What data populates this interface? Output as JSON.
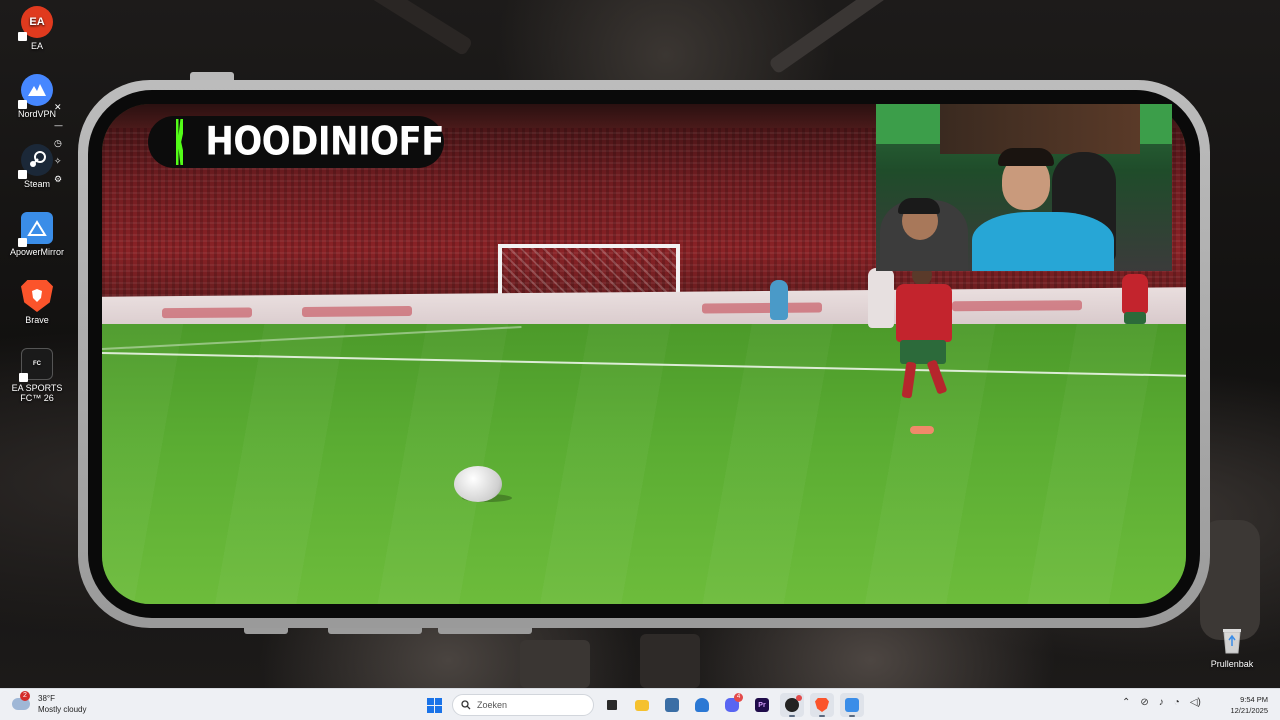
{
  "desktop_icons": [
    {
      "label": "EA",
      "icon": "ea-icon",
      "color": "#e03a1e"
    },
    {
      "label": "NordVPN",
      "icon": "nordvpn-icon",
      "color": "#4687ff"
    },
    {
      "label": "Steam",
      "icon": "steam-icon",
      "color": "#1b2838"
    },
    {
      "label": "ApowerMirror",
      "icon": "apowermirror-icon",
      "color": "#3a8de8"
    },
    {
      "label": "Brave",
      "icon": "brave-icon",
      "color": "#fb542b"
    },
    {
      "label": "EA SPORTS FC™ 26",
      "icon": "ea-sports-fc-icon",
      "color": "#1a1a1a"
    }
  ],
  "recycle_bin": {
    "label": "Prullenbak",
    "icon": "recycle-bin-icon"
  },
  "stream": {
    "watermark_name": "HOODINIOFF",
    "brand_color": "#53fc18"
  },
  "taskbar": {
    "weather_temp": "38°F",
    "weather_desc": "Mostly cloudy",
    "weather_badge": "2",
    "search_placeholder": "Zoeken",
    "discord_badge": "4",
    "time": "9:54 PM",
    "date": "12/21/2025",
    "apps": [
      "task-view-icon",
      "file-explorer-icon",
      "calculator-icon",
      "mail-icon",
      "discord-icon",
      "premiere-pro-icon",
      "obs-icon",
      "brave-icon",
      "apowermirror-icon"
    ]
  }
}
